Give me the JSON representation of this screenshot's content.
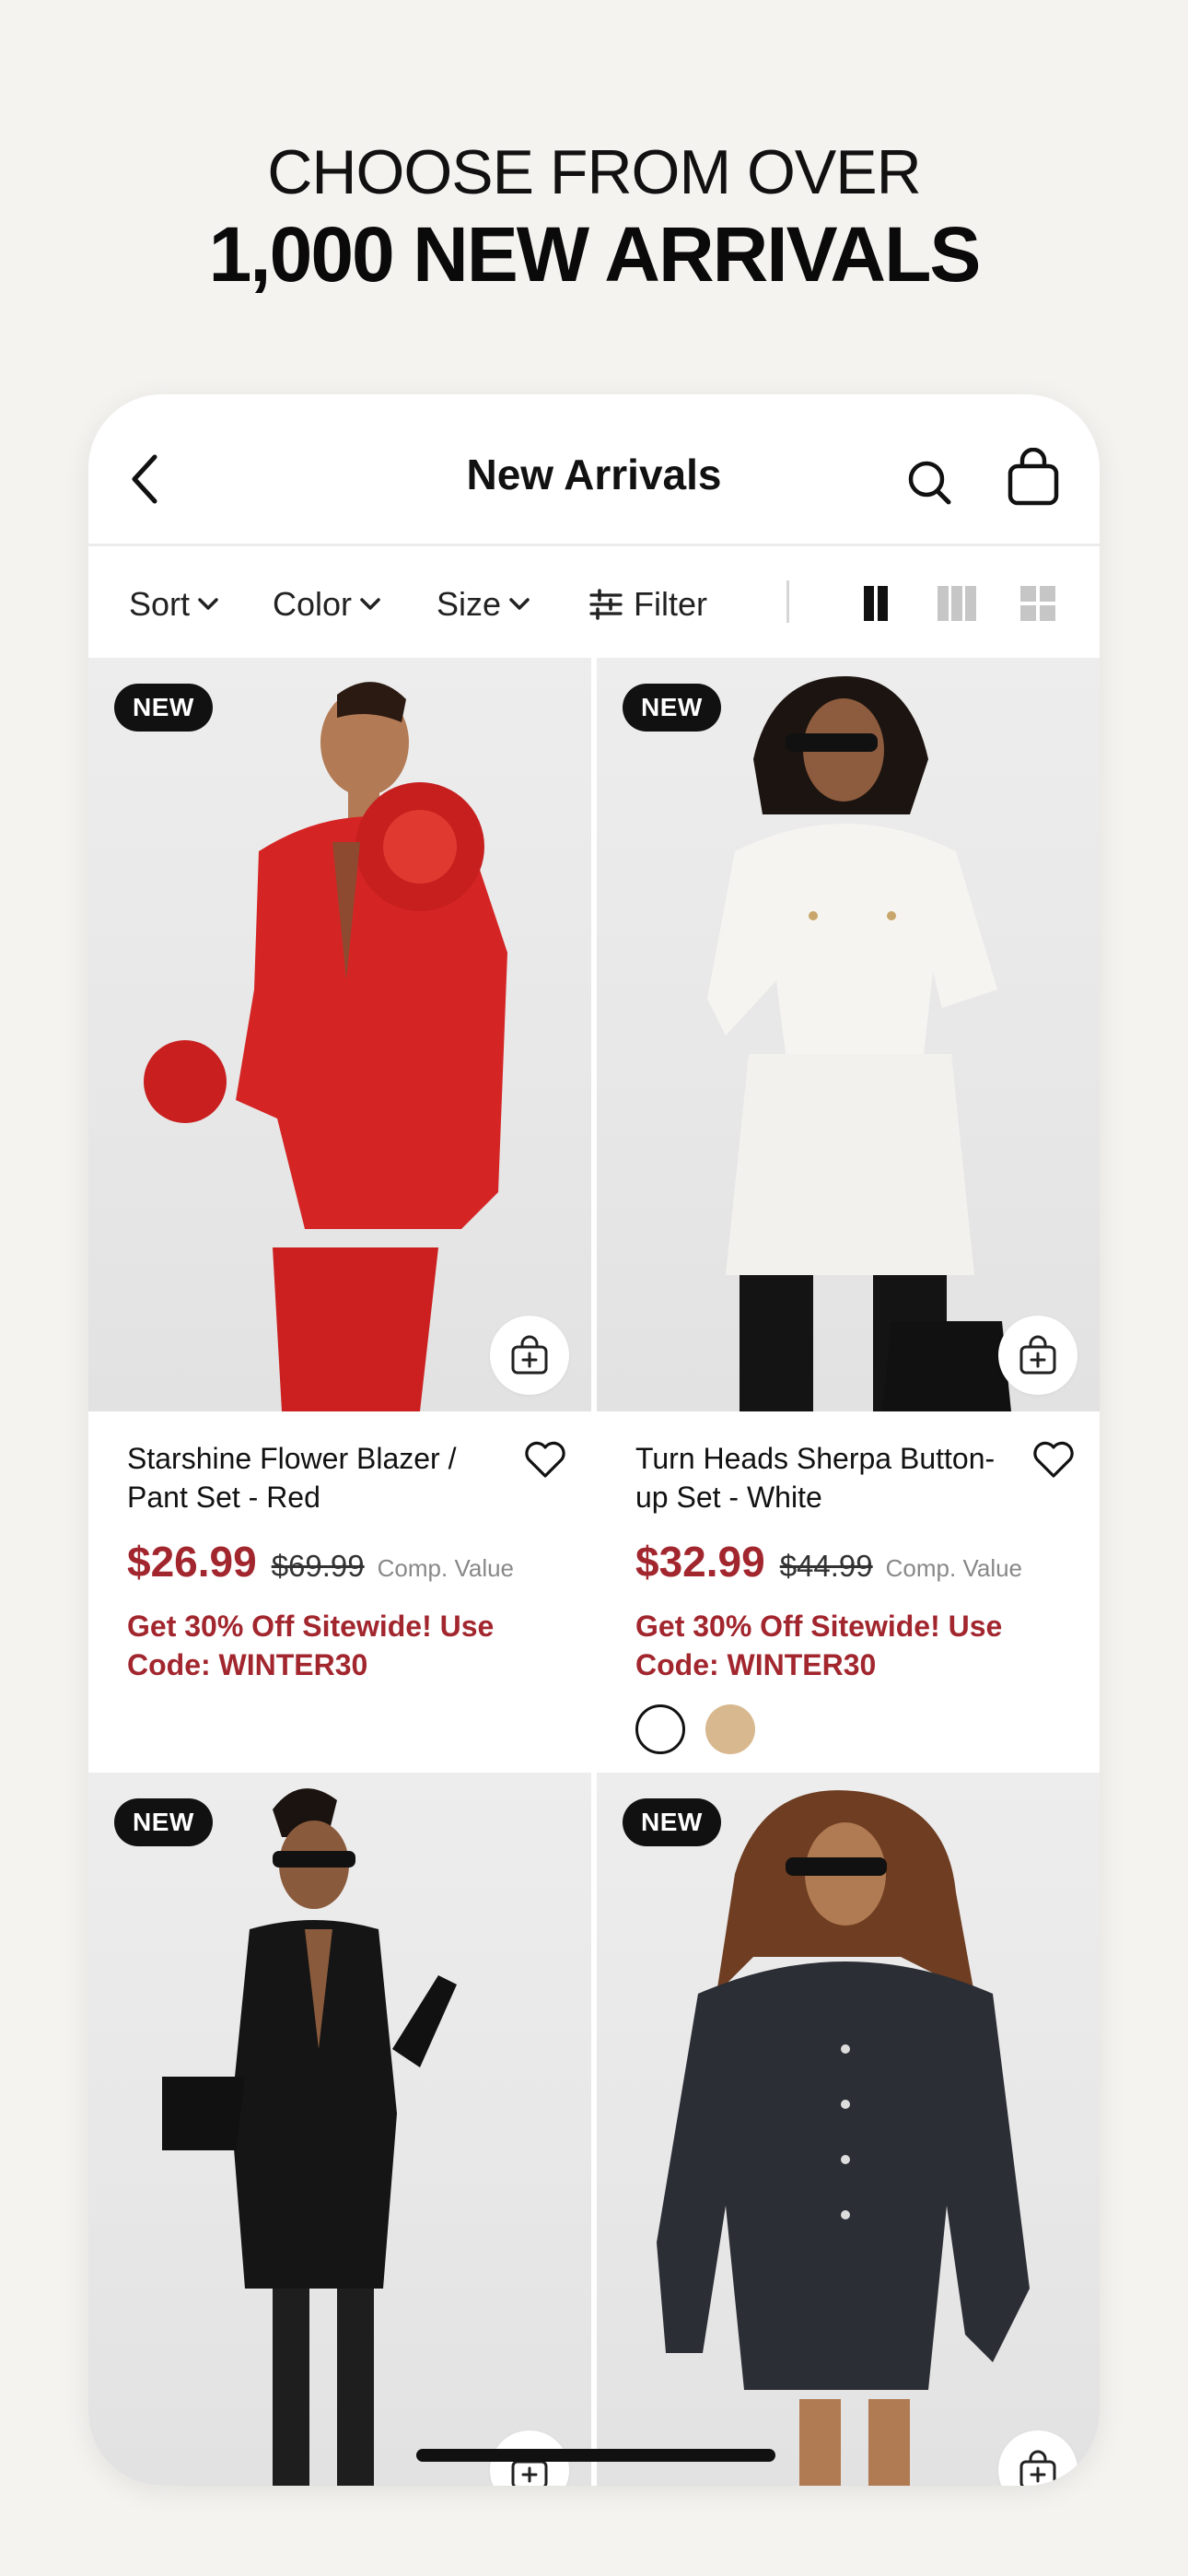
{
  "promo_header": {
    "line1": "CHOOSE FROM OVER",
    "line2": "1,000 NEW ARRIVALS"
  },
  "navbar": {
    "title": "New Arrivals",
    "icons": [
      "chevron-left-icon",
      "search-icon",
      "shopping-bag-icon"
    ]
  },
  "filters": {
    "sort": "Sort",
    "color": "Color",
    "size": "Size",
    "filter": "Filter",
    "view_modes": [
      "two-column-view-icon",
      "three-column-view-icon",
      "grid-view-icon"
    ],
    "active_view": "two-column-view-icon"
  },
  "products": [
    {
      "badge": "NEW",
      "name": "Starshine Flower Blazer / Pant Set - Red",
      "price": "$26.99",
      "old_price": "$69.99",
      "comp_label": "Comp. Value",
      "promo": "Get 30% Off Sitewide! Use Code: WINTER30",
      "swatches": []
    },
    {
      "badge": "NEW",
      "name": "Turn Heads Sherpa Button-up Set - White",
      "price": "$32.99",
      "old_price": "$44.99",
      "comp_label": "Comp. Value",
      "promo": "Get 30% Off Sitewide! Use Code: WINTER30",
      "swatches": [
        "#ffffff",
        "#d8b88e"
      ]
    },
    {
      "badge": "NEW"
    },
    {
      "badge": "NEW"
    }
  ],
  "colors": {
    "background": "#f5f3f0",
    "price_red": "#a2262e",
    "badge_black": "#111111"
  }
}
